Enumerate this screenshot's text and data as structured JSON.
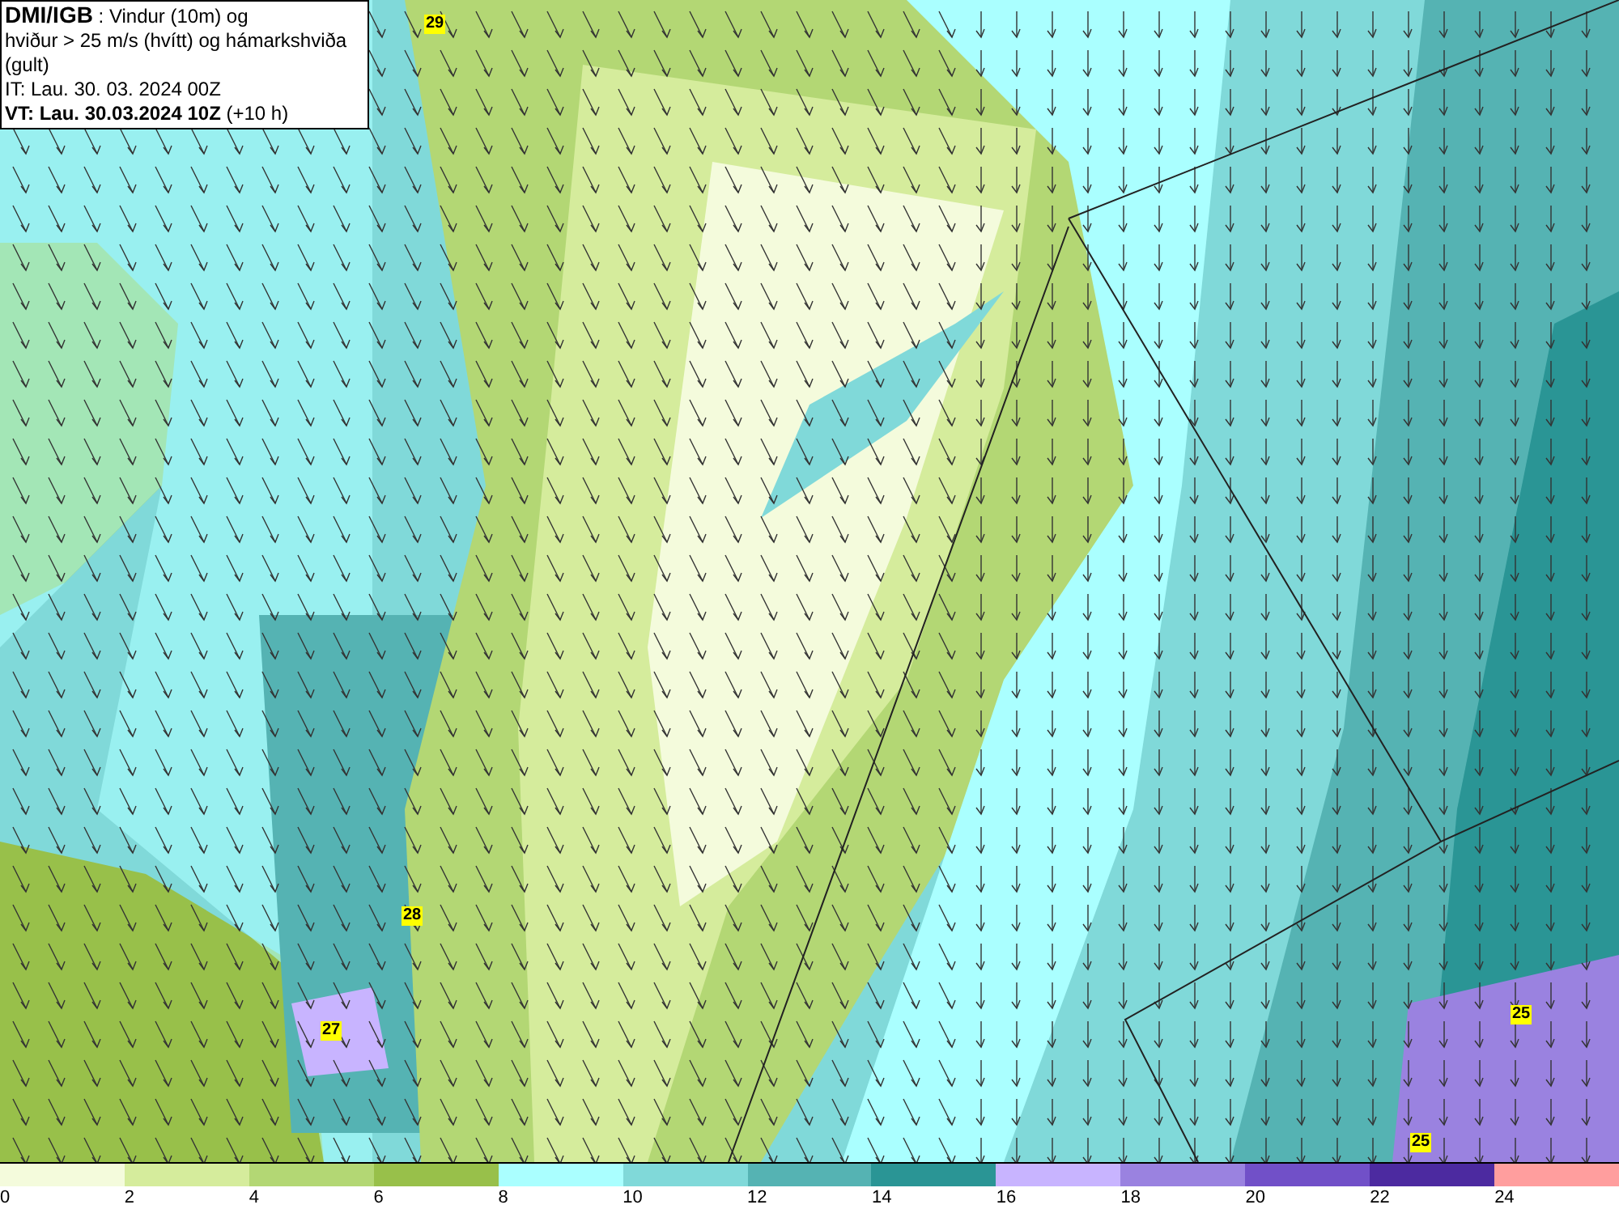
{
  "header": {
    "lines": [
      "**DMI/IGB** : Vindur (10m) og",
      "hviður > 25 m/s (hvítt) og hámarkshviða (gult)",
      "IT: Lau. 30. 03. 2024 00Z",
      "**VT: Lau. 30.03.2024 10Z** (+10 h)"
    ]
  },
  "gust_labels": [
    {
      "value": "29"
    },
    {
      "value": "28"
    },
    {
      "value": "27"
    },
    {
      "value": "25"
    },
    {
      "value": "25"
    }
  ],
  "legend": [
    {
      "label": "0",
      "color": "#f4fbdc"
    },
    {
      "label": "2",
      "color": "#d5ec9c"
    },
    {
      "label": "4",
      "color": "#b3d774"
    },
    {
      "label": "6",
      "color": "#98c04a"
    },
    {
      "label": "8",
      "color": "#aaffff"
    },
    {
      "label": "10",
      "color": "#80d9d9"
    },
    {
      "label": "12",
      "color": "#55b3b3"
    },
    {
      "label": "14",
      "color": "#2a9595"
    },
    {
      "label": "16",
      "color": "#c8b4ff"
    },
    {
      "label": "18",
      "color": "#9a82e0"
    },
    {
      "label": "20",
      "color": "#7150c8"
    },
    {
      "label": "22",
      "color": "#4c2aa0"
    },
    {
      "label": "24",
      "color": "#ff9e9e"
    }
  ]
}
